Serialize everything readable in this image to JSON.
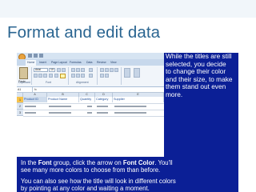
{
  "slide": {
    "title": "Format and edit data",
    "title_color": "#2a6591",
    "accent_color": "#0b1f96"
  },
  "excel": {
    "tabs": [
      "Home",
      "Insert",
      "Page Layout",
      "Formulas",
      "Data",
      "Review",
      "View"
    ],
    "ribbon": {
      "paste_label": "Paste",
      "font_name": "Arial",
      "font_size": "10",
      "groups": [
        "Clipboard",
        "Font",
        "Alignment"
      ]
    },
    "formula_bar": {
      "name_box": "A1",
      "fx": "fx"
    },
    "columns": [
      "A",
      "B",
      "C",
      "D",
      "E"
    ],
    "rows": [
      "1",
      "2",
      "3"
    ],
    "headers": [
      "Product ID",
      "Product Name",
      "Quantity",
      "Category",
      "Supplier"
    ]
  },
  "callouts": {
    "right_lines": [
      "While the titles are still",
      "selected, you decide",
      "to change their color",
      "and their size, to make",
      "them stand out even",
      "more."
    ],
    "bottom_p1": {
      "pre": "In the ",
      "b1": "Font",
      "mid": " group, click the arrow on ",
      "b2": "Font Color",
      "post": ". You'll",
      "line2": "see many more colors to choose from than before."
    },
    "bottom_p2": {
      "line1": "You can also see how the title will look in different colors",
      "line2": "by pointing at any color and waiting a moment."
    }
  }
}
